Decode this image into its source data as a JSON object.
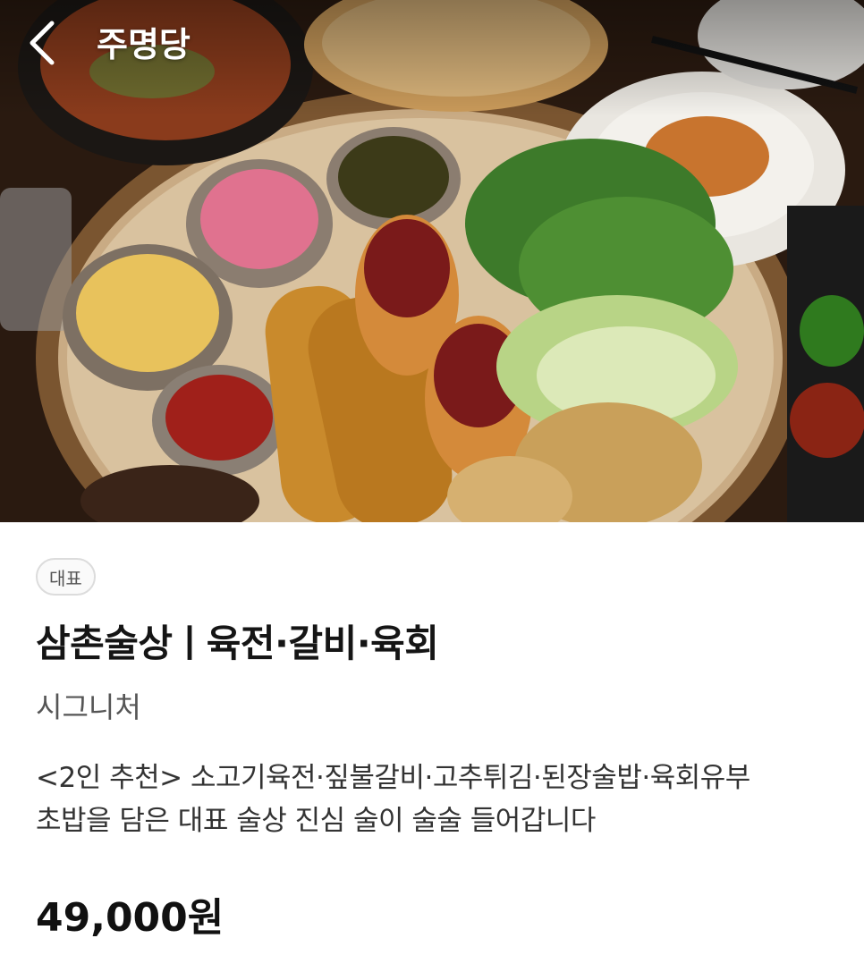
{
  "header": {
    "back_icon": "chevron-left-icon",
    "store_name": "주명당"
  },
  "hero": {
    "image_subject": "food-spread-photo"
  },
  "menu": {
    "badge": "대표",
    "title": "삼촌술상ㅣ육전·갈비·육회",
    "subtitle": "시그니처",
    "description_line1": "<2인 추천> 소고기육전·짚불갈비·고추튀김·된장술밥·육회유부",
    "description_line2": "초밥을 담은 대표 술상 진심 술이 술술 들어갑니다",
    "price": "49,000원"
  },
  "colors": {
    "accent_text": "#151515",
    "sub_text": "#555555",
    "badge_border": "#dcdcdc"
  }
}
